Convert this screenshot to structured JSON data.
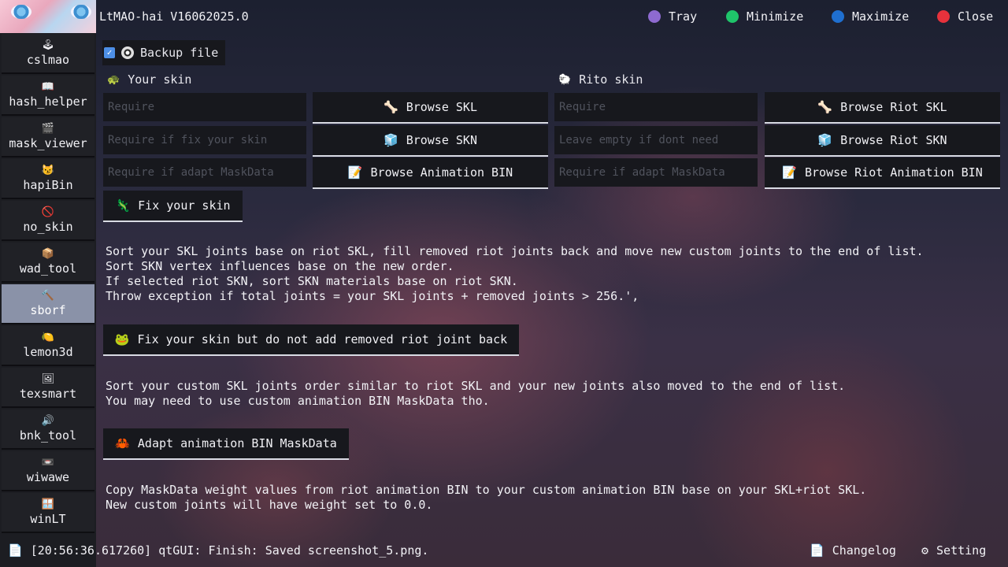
{
  "app": {
    "title": "LtMAO-hai V16062025.0"
  },
  "window_controls": [
    {
      "label": "Tray",
      "color": "#8e6ad0"
    },
    {
      "label": "Minimize",
      "color": "#1fc46a"
    },
    {
      "label": "Maximize",
      "color": "#1f6fd0"
    },
    {
      "label": "Close",
      "color": "#e6323c"
    }
  ],
  "sidebar": {
    "items": [
      {
        "label": "cslmao",
        "icon": "🕹"
      },
      {
        "label": "hash_helper",
        "icon": "📖"
      },
      {
        "label": "mask_viewer",
        "icon": "🎬"
      },
      {
        "label": "hapiBin",
        "icon": "😼"
      },
      {
        "label": "no_skin",
        "icon": "🚫"
      },
      {
        "label": "wad_tool",
        "icon": "📦"
      },
      {
        "label": "sborf",
        "icon": "🔨"
      },
      {
        "label": "lemon3d",
        "icon": "🍋"
      },
      {
        "label": "texsmart",
        "icon": "🖼"
      },
      {
        "label": "bnk_tool",
        "icon": "🔊"
      },
      {
        "label": "wiwawe",
        "icon": "📼"
      },
      {
        "label": "winLT",
        "icon": "🪟"
      }
    ],
    "active": "sborf"
  },
  "backup": {
    "label": "Backup file",
    "checked": true
  },
  "your_skin": {
    "title": "Your skin",
    "icon": "🐢",
    "inputs": [
      {
        "placeholder": "Require"
      },
      {
        "placeholder": "Require if fix your skin"
      },
      {
        "placeholder": "Require if adapt MaskData"
      }
    ],
    "buttons": [
      {
        "label": "Browse SKL",
        "icon": "🦴"
      },
      {
        "label": "Browse SKN",
        "icon": "🧊"
      },
      {
        "label": "Browse Animation BIN",
        "icon": "📝"
      }
    ]
  },
  "riot_skin": {
    "title": "Rito skin",
    "icon": "🐑",
    "inputs": [
      {
        "placeholder": "Require"
      },
      {
        "placeholder": "Leave empty if dont need"
      },
      {
        "placeholder": "Require if adapt MaskData"
      }
    ],
    "buttons": [
      {
        "label": "Browse Riot SKL",
        "icon": "🦴"
      },
      {
        "label": "Browse Riot SKN",
        "icon": "🧊"
      },
      {
        "label": "Browse Riot Animation BIN",
        "icon": "📝"
      }
    ]
  },
  "actions": [
    {
      "label": "Fix your skin",
      "icon": "🦎",
      "description": "Sort your SKL joints base on riot SKL, fill removed riot joints back and move new custom joints to the end of list.\nSort SKN vertex influences base on the new order.\nIf selected riot SKN, sort SKN materials base on riot SKN.\nThrow exception if total joints = your SKL joints + removed joints > 256.',"
    },
    {
      "label": "Fix your skin but do not add removed riot joint back",
      "icon": "🐸",
      "description": "Sort your custom SKL joints order similar to riot SKL and your new joints also moved to the end of list.\nYou may need to use custom animation BIN MaskData tho."
    },
    {
      "label": "Adapt animation BIN MaskData",
      "icon": "🦀",
      "description": "Copy MaskData weight values from riot animation BIN to your custom animation BIN base on your SKL+riot SKL.\nNew custom joints will have weight set to 0.0."
    }
  ],
  "status": {
    "text": "[20:56:36.617260] qtGUI: Finish: Saved screenshot_5.png.",
    "icon": "📄"
  },
  "footer": {
    "changelog": {
      "label": "Changelog",
      "icon": "📄"
    },
    "setting": {
      "label": "Setting",
      "icon": "⚙"
    }
  }
}
